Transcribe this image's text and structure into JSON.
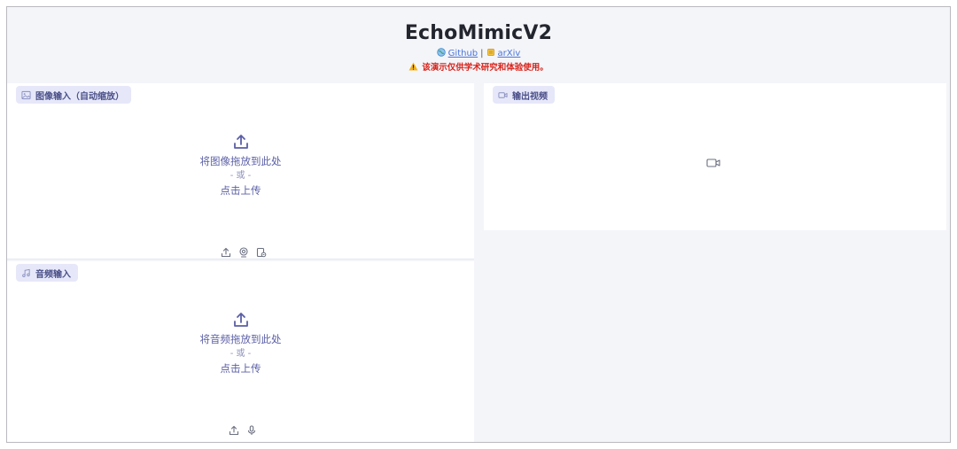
{
  "header": {
    "title": "EchoMimicV2",
    "github_label": "Github",
    "separator": "|",
    "arxiv_label": "arXiv",
    "warning": "该演示仅供学术研究和体验使用。"
  },
  "image_input": {
    "label": "图像输入（自动缩放）",
    "drop_text": "将图像拖放到此处",
    "or_text": "- 或 -",
    "click_text": "点击上传",
    "tool_icons": [
      "upload-icon",
      "webcam-icon",
      "clipboard-icon"
    ]
  },
  "audio_input": {
    "label": "音频输入",
    "drop_text": "将音频拖放到此处",
    "or_text": "- 或 -",
    "click_text": "点击上传",
    "tool_icons": [
      "upload-icon",
      "microphone-icon"
    ]
  },
  "video_output": {
    "label": "输出视频",
    "placeholder_icon": "video-camera-icon"
  },
  "colors": {
    "accent": "#5b5fa6",
    "chip_bg": "#e6e8f9",
    "warning": "#d8231b",
    "link": "#4a74d8",
    "page_bg": "#f4f5f9"
  }
}
